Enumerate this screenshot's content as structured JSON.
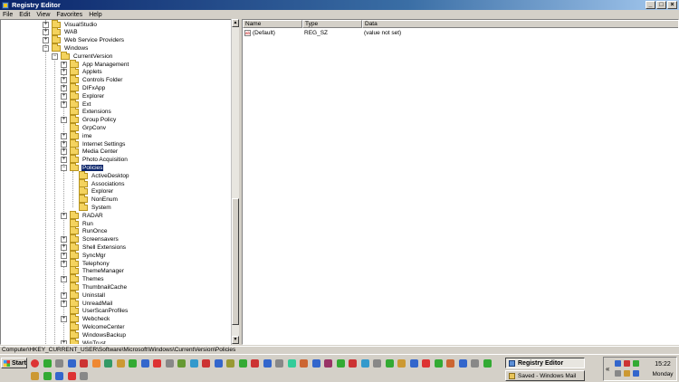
{
  "window": {
    "title": "Registry Editor",
    "minimize": "_",
    "maximize": "□",
    "close": "×"
  },
  "menu": [
    "File",
    "Edit",
    "View",
    "Favorites",
    "Help"
  ],
  "tree": [
    {
      "label": "VisualStudio",
      "expander": "+"
    },
    {
      "label": "WAB",
      "expander": "+"
    },
    {
      "label": "Web Service Providers",
      "expander": "+"
    },
    {
      "label": "Windows",
      "expander": "−"
    },
    {
      "label": "CurrentVersion",
      "expander": "−"
    },
    {
      "label": "App Management",
      "expander": "+"
    },
    {
      "label": "Applets",
      "expander": "+"
    },
    {
      "label": "Controls Folder",
      "expander": "+"
    },
    {
      "label": "DIFxApp",
      "expander": "+"
    },
    {
      "label": "Explorer",
      "expander": "+"
    },
    {
      "label": "Ext",
      "expander": "+"
    },
    {
      "label": "Extensions",
      "expander": ""
    },
    {
      "label": "Group Policy",
      "expander": "+"
    },
    {
      "label": "GrpConv",
      "expander": ""
    },
    {
      "label": "ime",
      "expander": "+"
    },
    {
      "label": "Internet Settings",
      "expander": "+"
    },
    {
      "label": "Media Center",
      "expander": "+"
    },
    {
      "label": "Photo Acquisition",
      "expander": "+"
    },
    {
      "label": "Policies",
      "expander": "−"
    },
    {
      "label": "ActiveDesktop",
      "expander": ""
    },
    {
      "label": "Associations",
      "expander": ""
    },
    {
      "label": "Explorer",
      "expander": ""
    },
    {
      "label": "NonEnum",
      "expander": ""
    },
    {
      "label": "System",
      "expander": ""
    },
    {
      "label": "RADAR",
      "expander": "+"
    },
    {
      "label": "Run",
      "expander": ""
    },
    {
      "label": "RunOnce",
      "expander": ""
    },
    {
      "label": "Screensavers",
      "expander": "+"
    },
    {
      "label": "Shell Extensions",
      "expander": "+"
    },
    {
      "label": "SyncMgr",
      "expander": "+"
    },
    {
      "label": "Telephony",
      "expander": "+"
    },
    {
      "label": "ThemeManager",
      "expander": ""
    },
    {
      "label": "Themes",
      "expander": "+"
    },
    {
      "label": "ThumbnailCache",
      "expander": ""
    },
    {
      "label": "Uninstall",
      "expander": "+"
    },
    {
      "label": "UnreadMail",
      "expander": "+"
    },
    {
      "label": "UserScanProfiles",
      "expander": ""
    },
    {
      "label": "Webcheck",
      "expander": "+"
    },
    {
      "label": "WelcomeCenter",
      "expander": ""
    },
    {
      "label": "WindowsBackup",
      "expander": ""
    },
    {
      "label": "WinTrust",
      "expander": "+"
    }
  ],
  "selected_tree_item": "Policies",
  "list": {
    "columns": [
      "Name",
      "Type",
      "Data"
    ],
    "rows": [
      {
        "icon": "ab",
        "name": "(Default)",
        "type": "REG_SZ",
        "data": "(value not set)"
      }
    ]
  },
  "status_path": "Computer\\HKEY_CURRENT_USER\\Software\\Microsoft\\Windows\\CurrentVersion\\Policies",
  "taskbar": {
    "start": "Start",
    "tasks": [
      {
        "label": "Registry Editor",
        "active": true
      },
      {
        "label": "Saved - Windows Mail",
        "active": false
      }
    ],
    "tray_chevron": "«",
    "time": "15:22",
    "day": "Monday"
  },
  "colors": {
    "title_start": "#0a246a",
    "title_end": "#a6caf0",
    "selection": "#0a246a",
    "chrome": "#d4d0c8"
  }
}
